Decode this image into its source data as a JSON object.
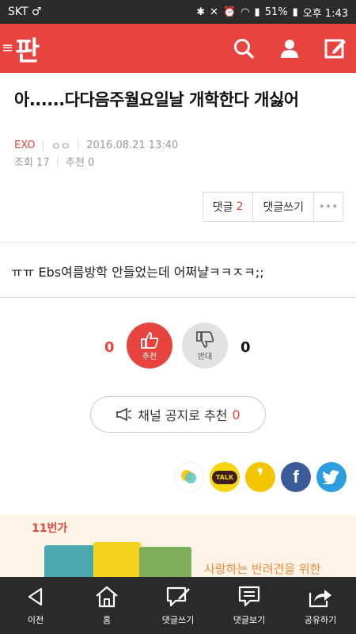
{
  "status": {
    "carrier": "SKT ♂",
    "battery": "51%",
    "time": "오후 1:43"
  },
  "app": {
    "logo": "판",
    "icons": [
      "search-icon",
      "user-icon",
      "write-icon"
    ]
  },
  "post": {
    "title": "아......다다음주월요일날 개학한다 개싫어",
    "author": "EXO",
    "author_sub": "ㅇㅇ",
    "datetime": "2016.08.21 13:40",
    "views_label": "조회 17",
    "recommend_label": "추천 0",
    "body": "ㅠㅠ Ebs여름방학 안들었는데 어쩌냘ㅋㅋㅈㅋ;;"
  },
  "comments_bar": {
    "comment_label": "댓글",
    "comment_count": "2",
    "write_label": "댓글쓰기",
    "more": "•••"
  },
  "vote": {
    "up_count": "0",
    "down_count": "0",
    "up_label": "추천",
    "down_label": "반대"
  },
  "notice": {
    "label": "채널 공지로 추천",
    "count": "0"
  },
  "share": {
    "icons": [
      "kakaostory-icon",
      "kakaotalk-icon",
      "quote-icon",
      "facebook-icon",
      "twitter-icon"
    ],
    "talk_label": "TALK"
  },
  "ad": {
    "brand": "11번가",
    "copy": "사랑하는 반려견을 위한"
  },
  "bottom_nav": [
    {
      "label": "이전",
      "icon": "back-icon"
    },
    {
      "label": "홈",
      "icon": "home-icon"
    },
    {
      "label": "댓글쓰기",
      "icon": "write-comment-icon"
    },
    {
      "label": "댓글보기",
      "icon": "view-comment-icon"
    },
    {
      "label": "공유하기",
      "icon": "share-icon"
    }
  ],
  "colors": {
    "brand": "#e8443f",
    "statusbar": "#2b2b2b",
    "bottom_nav": "#2a2a2a"
  }
}
